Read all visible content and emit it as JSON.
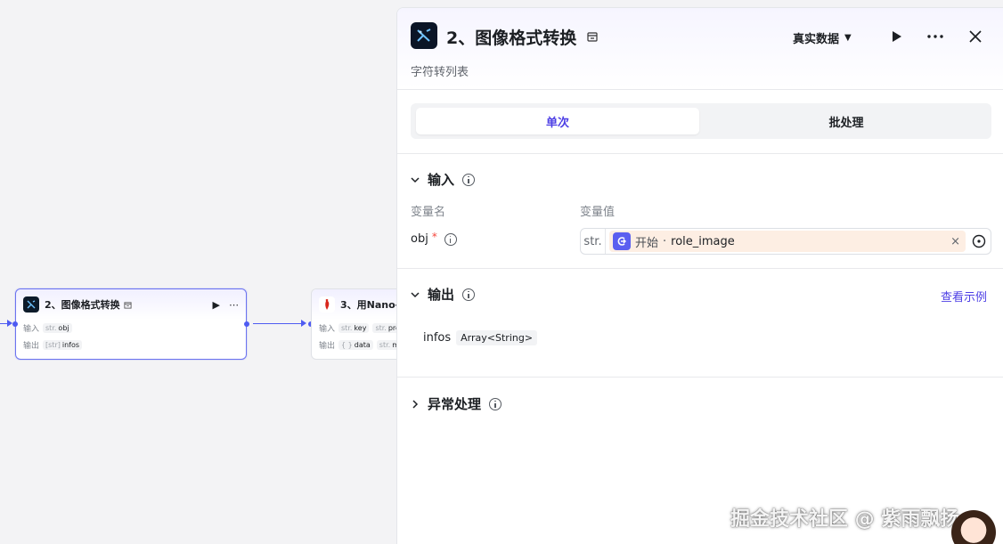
{
  "canvas": {
    "node_current": {
      "title": "2、图像格式转换",
      "input_label": "输入",
      "input_type": "str.",
      "input_value": "obj",
      "output_label": "输出",
      "output_type": "[str]",
      "output_value": "infos"
    },
    "node_next": {
      "title": "3、用Nano-",
      "input_label": "输入",
      "input_type1": "str.",
      "input_value1": "key",
      "input_type2": "str.",
      "input_value2": "pro",
      "output_label": "输出",
      "output_type1": "{ }",
      "output_value1": "data",
      "output_type2": "str.",
      "output_value2": "m"
    }
  },
  "panel": {
    "title": "2、图像格式转换",
    "subtitle": "字符转列表",
    "data_mode": "真实数据",
    "tabs": [
      {
        "label": "单次",
        "active": true
      },
      {
        "label": "批处理",
        "active": false
      }
    ],
    "input": {
      "section_title": "输入",
      "col_name": "变量名",
      "col_value": "变量值",
      "var_name": "obj",
      "required_mark": "*",
      "type_prefix": "str.",
      "ref_source": "开始",
      "ref_sep": "·",
      "ref_var": "role_image",
      "clear_symbol": "×"
    },
    "output": {
      "section_title": "输出",
      "example_link": "查看示例",
      "var_name": "infos",
      "var_type": "Array<String>"
    },
    "exception": {
      "section_title": "异常处理"
    }
  },
  "watermark": "掘金技术社区 @ 紫雨飘扬",
  "colors": {
    "accent": "#4e40e5",
    "connector": "#4e5bf2",
    "ref_bg": "#fdeee3",
    "required": "#f5463c"
  }
}
